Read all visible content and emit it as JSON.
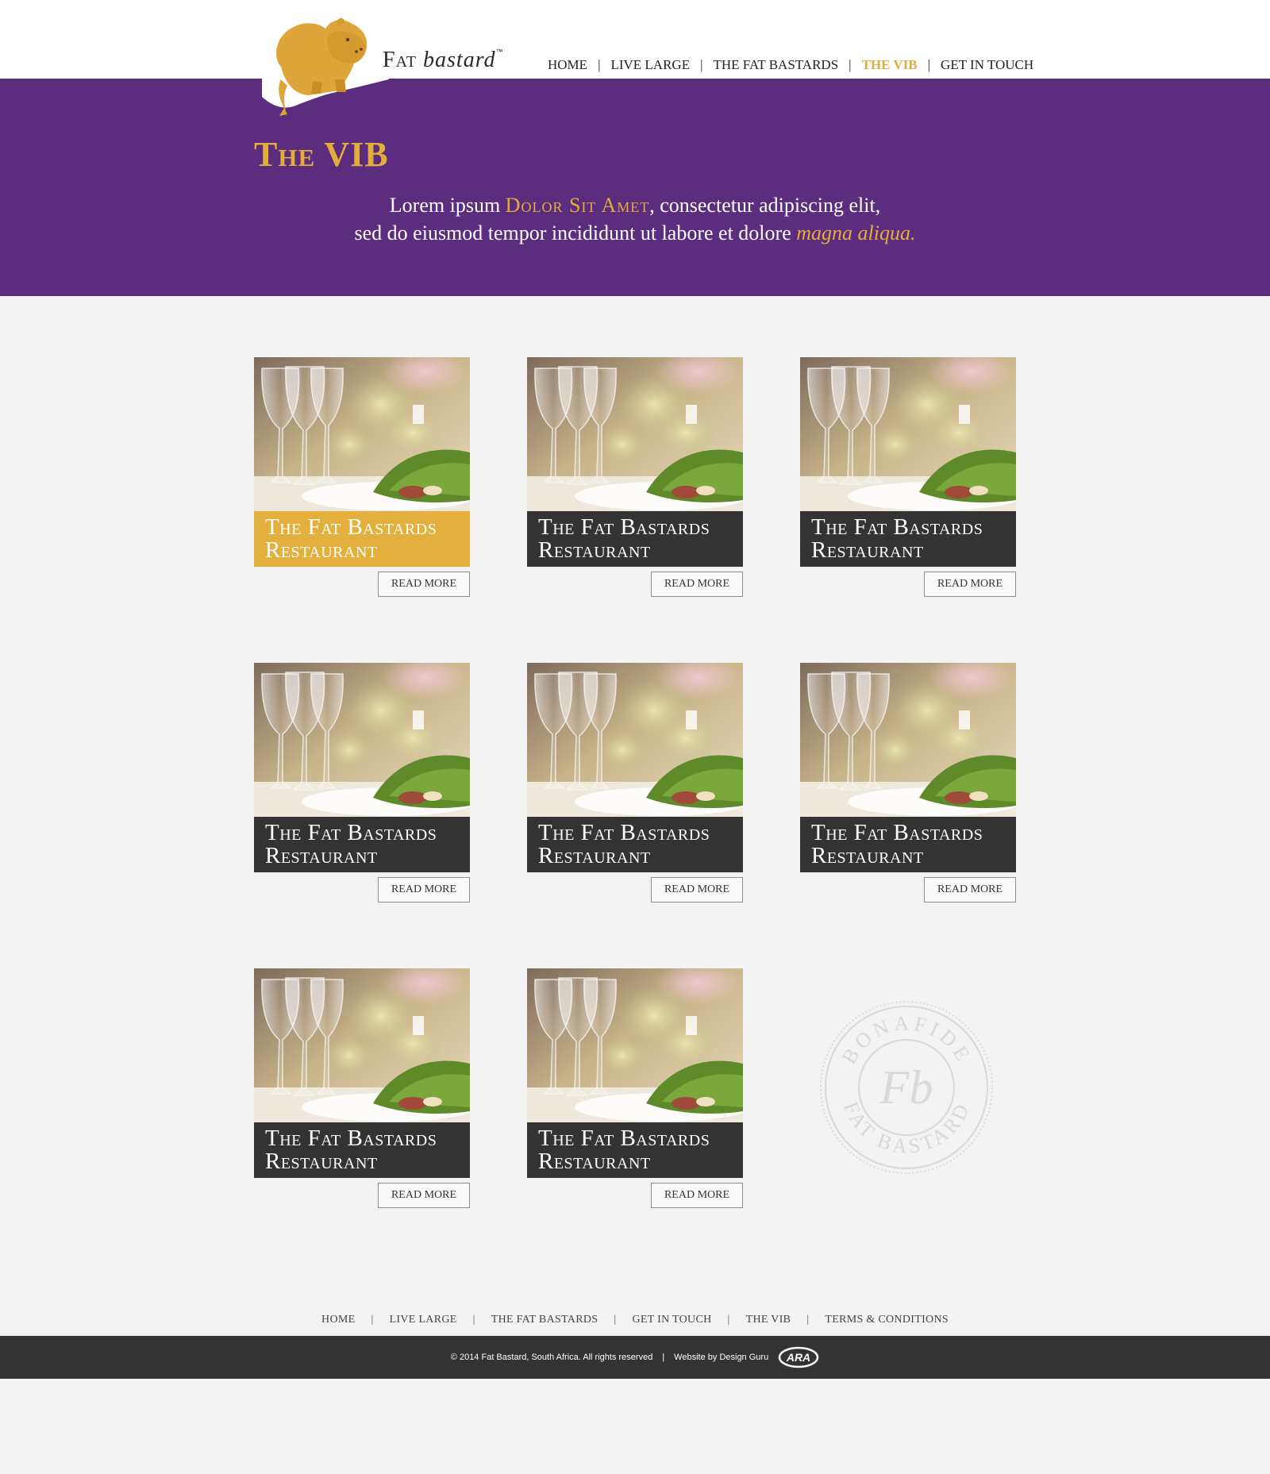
{
  "brand": {
    "word_fat": "Fat",
    "word_bastard": "bastard",
    "trademark": "™"
  },
  "nav": {
    "items": [
      {
        "label": "HOME"
      },
      {
        "label": "LIVE LARGE"
      },
      {
        "label": "THE FAT BASTARDS"
      },
      {
        "label": "THE VIB",
        "active": true
      },
      {
        "label": "GET IN TOUCH"
      }
    ],
    "separator": "|"
  },
  "hero": {
    "title": "The VIB",
    "line1_a": "Lorem ipsum ",
    "line1_highlight": "Dolor Sit Amet",
    "line1_b": ", consectetur adipiscing elit,",
    "line2_a": "sed do eiusmod tempor incididunt ut labore et dolore ",
    "line2_highlight": "magna aliqua."
  },
  "cards": [
    {
      "line1": "The Fat Bastards",
      "line2": "Restaurant",
      "button": "READ MORE",
      "featured": true
    },
    {
      "line1": "The Fat Bastards",
      "line2": "Restaurant",
      "button": "READ MORE"
    },
    {
      "line1": "The Fat Bastards",
      "line2": "Restaurant",
      "button": "READ MORE"
    },
    {
      "line1": "The Fat Bastards",
      "line2": "Restaurant",
      "button": "READ MORE"
    },
    {
      "line1": "The Fat Bastards",
      "line2": "Restaurant",
      "button": "READ MORE"
    },
    {
      "line1": "The Fat Bastards",
      "line2": "Restaurant",
      "button": "READ MORE"
    },
    {
      "line1": "The Fat Bastards",
      "line2": "Restaurant",
      "button": "READ MORE"
    },
    {
      "line1": "The Fat Bastards",
      "line2": "Restaurant",
      "button": "READ MORE"
    }
  ],
  "stamp": {
    "top_text": "BONAFIDE",
    "bottom_text": "FAT BASTARD",
    "monogram": "Fb"
  },
  "footer": {
    "nav": [
      {
        "label": "HOME"
      },
      {
        "label": "LIVE LARGE"
      },
      {
        "label": "THE FAT BASTARDS"
      },
      {
        "label": "GET IN TOUCH"
      },
      {
        "label": "THE VIB"
      },
      {
        "label": "TERMS & CONDITIONS"
      }
    ],
    "separator": "|",
    "copyright": "© 2014 Fat Bastard, South Africa. All rights reserved",
    "credit": "Website by Design Guru",
    "credit_logo": "ARA"
  },
  "colors": {
    "purple": "#5c2c7f",
    "gold": "#e3ad3a",
    "dark": "#333333",
    "page_bg": "#f3f3f3"
  },
  "icons": {
    "logo": "hippo-logo-icon",
    "stamp": "bonafide-stamp-icon",
    "credit": "ara-logo-icon"
  }
}
